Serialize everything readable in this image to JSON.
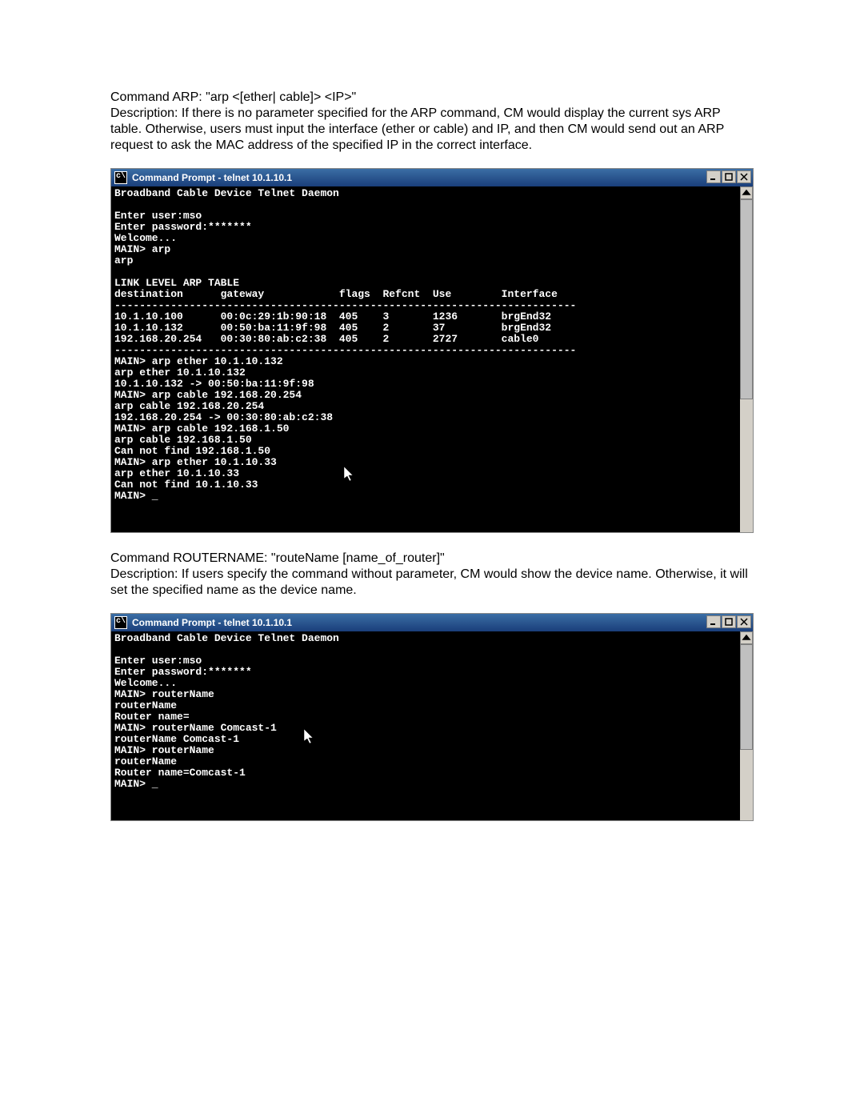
{
  "section1": {
    "title": "Command ARP: \"arp <[ether| cable]> <IP>\"",
    "description": "Description: If there is no parameter specified for the ARP command, CM would display the current sys ARP table.  Otherwise, users must input the interface (ether or cable) and IP, and then CM would send out an ARP request to ask the MAC address of the specified IP in the correct interface."
  },
  "window1": {
    "title": "Command Prompt - telnet 10.1.10.1",
    "icon_glyph": "c\\",
    "lines": [
      "Broadband Cable Device Telnet Daemon",
      "",
      "Enter user:mso",
      "Enter password:*******",
      "Welcome...",
      "MAIN> arp",
      "arp",
      "",
      "LINK LEVEL ARP TABLE",
      "destination      gateway            flags  Refcnt  Use        Interface",
      "--------------------------------------------------------------------------",
      "10.1.10.100      00:0c:29:1b:90:18  405    3       1236       brgEnd32",
      "10.1.10.132      00:50:ba:11:9f:98  405    2       37         brgEnd32",
      "192.168.20.254   00:30:80:ab:c2:38  405    2       2727       cable0",
      "--------------------------------------------------------------------------",
      "MAIN> arp ether 10.1.10.132",
      "arp ether 10.1.10.132",
      "10.1.10.132 -> 00:50:ba:11:9f:98",
      "MAIN> arp cable 192.168.20.254",
      "arp cable 192.168.20.254",
      "192.168.20.254 -> 00:30:80:ab:c2:38",
      "MAIN> arp cable 192.168.1.50",
      "arp cable 192.168.1.50",
      "Can not find 192.168.1.50",
      "MAIN> arp ether 10.1.10.33",
      "arp ether 10.1.10.33",
      "Can not find 10.1.10.33",
      "MAIN> _"
    ]
  },
  "section2": {
    "title": "Command ROUTERNAME: \"routeName [name_of_router]\"",
    "description": "Description: If users specify the command without parameter, CM would show the device name. Otherwise, it will set the specified name as the device name."
  },
  "window2": {
    "title": "Command Prompt - telnet 10.1.10.1",
    "icon_glyph": "c\\",
    "lines": [
      "Broadband Cable Device Telnet Daemon",
      "",
      "Enter user:mso",
      "Enter password:*******",
      "Welcome...",
      "MAIN> routerName",
      "routerName",
      "Router name=",
      "MAIN> routerName Comcast-1",
      "routerName Comcast-1",
      "MAIN> routerName",
      "routerName",
      "Router name=Comcast-1",
      "MAIN> _"
    ]
  }
}
